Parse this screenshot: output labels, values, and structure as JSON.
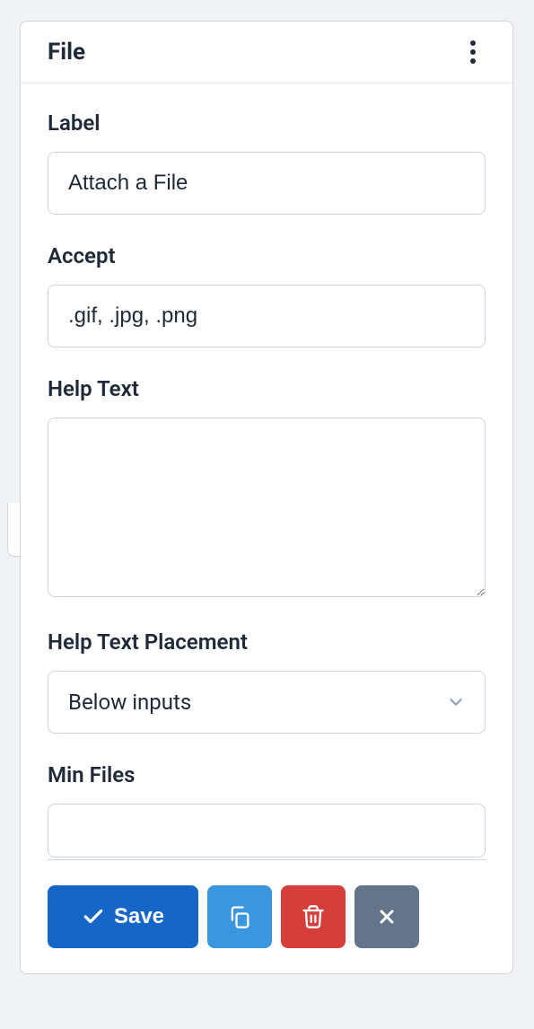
{
  "panel": {
    "title": "File"
  },
  "fields": {
    "label": {
      "label": "Label",
      "value": "Attach a File"
    },
    "accept": {
      "label": "Accept",
      "value": ".gif, .jpg, .png"
    },
    "helpText": {
      "label": "Help Text",
      "value": ""
    },
    "helpTextPlacement": {
      "label": "Help Text Placement",
      "value": "Below inputs"
    },
    "minFiles": {
      "label": "Min Files",
      "value": ""
    }
  },
  "buttons": {
    "save": "Save"
  }
}
